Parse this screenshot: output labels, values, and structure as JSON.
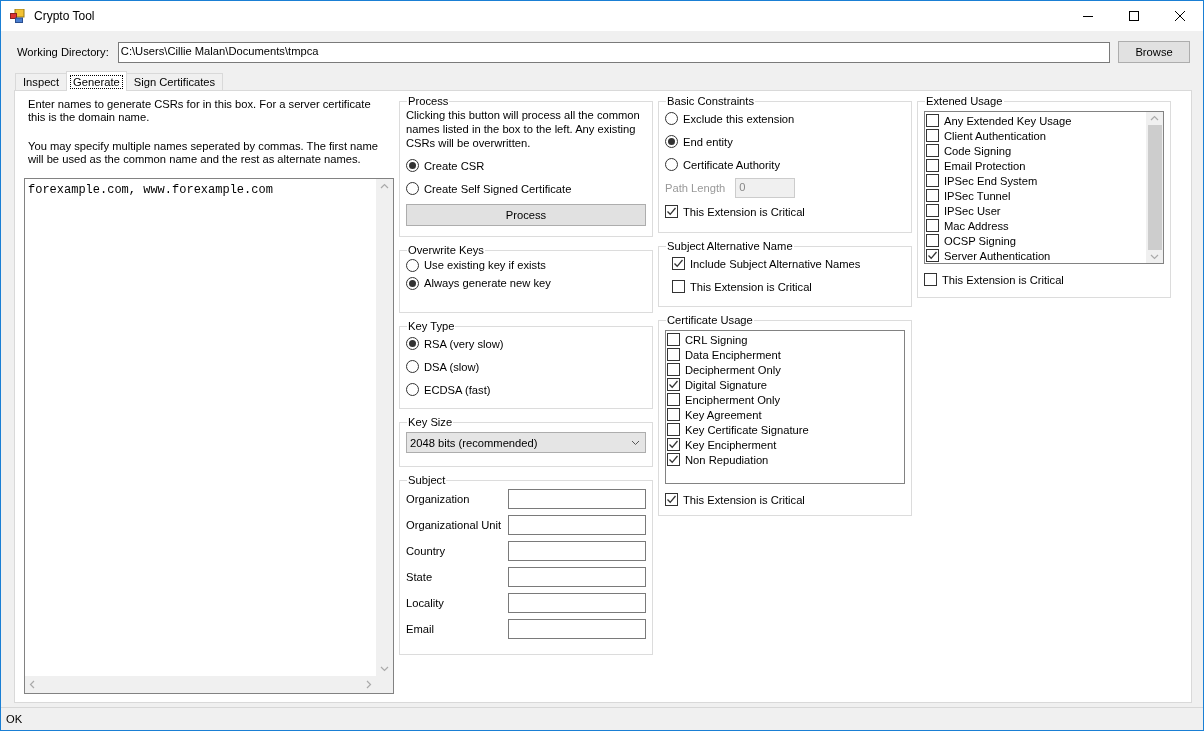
{
  "window": {
    "title": "Crypto Tool"
  },
  "working_directory": {
    "label": "Working Directory:",
    "value": "C:\\Users\\Cillie Malan\\Documents\\tmpca",
    "button": "Browse"
  },
  "tabs": [
    {
      "label": "Inspect",
      "selected": false
    },
    {
      "label": "Generate",
      "selected": true
    },
    {
      "label": "Sign Certificates",
      "selected": false
    }
  ],
  "names": {
    "instructions": [
      "Enter names to generate CSRs for in this box. For a server certificate this is the domain name.",
      "You may specify multiple names seperated by commas. The first name will be used as the common name and the rest as alternate names."
    ],
    "value": "forexample.com, www.forexample.com"
  },
  "process": {
    "title": "Process",
    "description": "Clicking this button will process all the common names listed in the box to the left. Any existing CSRs will be overwritten.",
    "options": [
      {
        "label": "Create CSR",
        "selected": true
      },
      {
        "label": "Create Self Signed Certificate",
        "selected": false
      }
    ],
    "button": "Process"
  },
  "overwrite_keys": {
    "title": "Overwrite Keys",
    "options": [
      {
        "label": "Use existing key if exists",
        "selected": false
      },
      {
        "label": "Always generate new key",
        "selected": true
      }
    ]
  },
  "key_type": {
    "title": "Key Type",
    "options": [
      {
        "label": "RSA (very slow)",
        "selected": true
      },
      {
        "label": "DSA (slow)",
        "selected": false
      },
      {
        "label": "ECDSA (fast)",
        "selected": false
      }
    ]
  },
  "key_size": {
    "title": "Key Size",
    "value": "2048 bits (recommended)"
  },
  "subject": {
    "title": "Subject",
    "fields": [
      {
        "label": "Organization"
      },
      {
        "label": "Organizational Unit"
      },
      {
        "label": "Country"
      },
      {
        "label": "State"
      },
      {
        "label": "Locality"
      },
      {
        "label": "Email"
      }
    ]
  },
  "basic_constraints": {
    "title": "Basic Constraints",
    "options": [
      {
        "label": "Exclude this extension",
        "selected": false
      },
      {
        "label": "End entity",
        "selected": true
      },
      {
        "label": "Certificate Authority",
        "selected": false
      }
    ],
    "path_length": {
      "label": "Path Length",
      "value": "0",
      "disabled": true
    },
    "critical": {
      "label": "This Extension is Critical",
      "checked": true
    }
  },
  "subject_alternative_name": {
    "title": "Subject Alternative Name",
    "include": {
      "label": "Include Subject Alternative Names",
      "checked": true
    },
    "critical": {
      "label": "This Extension is Critical",
      "checked": false
    }
  },
  "certificate_usage": {
    "title": "Certificate Usage",
    "items": [
      {
        "label": "CRL Signing",
        "checked": false
      },
      {
        "label": "Data Encipherment",
        "checked": false
      },
      {
        "label": "Decipherment Only",
        "checked": false
      },
      {
        "label": "Digital Signature",
        "checked": true
      },
      {
        "label": "Encipherment Only",
        "checked": false
      },
      {
        "label": "Key Agreement",
        "checked": false
      },
      {
        "label": "Key Certificate Signature",
        "checked": false
      },
      {
        "label": "Key Encipherment",
        "checked": true
      },
      {
        "label": "Non Repudiation",
        "checked": true
      }
    ],
    "critical": {
      "label": "This Extension is Critical",
      "checked": true
    }
  },
  "extended_usage": {
    "title": "Extened Usage",
    "items": [
      {
        "label": "Any Extended Key Usage",
        "checked": false
      },
      {
        "label": "Client Authentication",
        "checked": false
      },
      {
        "label": "Code Signing",
        "checked": false
      },
      {
        "label": "Email Protection",
        "checked": false
      },
      {
        "label": "IPSec End System",
        "checked": false
      },
      {
        "label": "IPSec Tunnel",
        "checked": false
      },
      {
        "label": "IPSec User",
        "checked": false
      },
      {
        "label": "Mac Address",
        "checked": false
      },
      {
        "label": "OCSP Signing",
        "checked": false
      },
      {
        "label": "Server Authentication",
        "checked": true
      }
    ],
    "critical": {
      "label": "This Extension is Critical",
      "checked": false
    }
  },
  "status_bar": {
    "text": "OK"
  }
}
